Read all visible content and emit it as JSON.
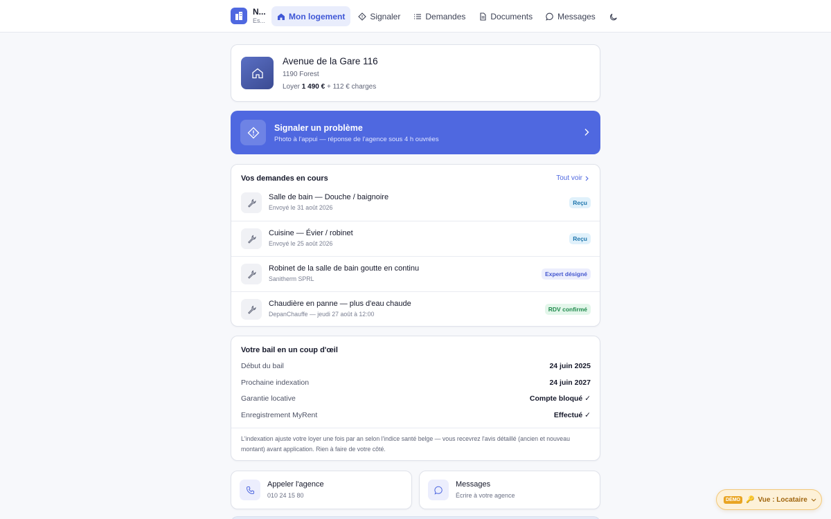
{
  "brand": {
    "name": "N...",
    "sub": "Es..."
  },
  "nav": {
    "items": [
      {
        "label": "Mon logement"
      },
      {
        "label": "Signaler"
      },
      {
        "label": "Demandes"
      },
      {
        "label": "Documents"
      },
      {
        "label": "Messages"
      }
    ]
  },
  "property": {
    "address": "Avenue de la Gare 116",
    "city": "1190 Forest",
    "rent_prefix": "Loyer",
    "rent": "1 490 €",
    "charges": "+ 112 € charges"
  },
  "report": {
    "title": "Signaler un problème",
    "subtitle": "Photo à l'appui — réponse de l'agence sous 4 h ouvrées"
  },
  "requests": {
    "title": "Vos demandes en cours",
    "see_all": "Tout voir",
    "items": [
      {
        "title": "Salle de bain — Douche / baignoire",
        "sub": "Envoyé le 31 août 2026",
        "status": "Reçu"
      },
      {
        "title": "Cuisine — Évier / robinet",
        "sub": "Envoyé le 25 août 2026",
        "status": "Reçu"
      },
      {
        "title": "Robinet de la salle de bain goutte en continu",
        "sub": "Sanitherm SPRL",
        "status": "Expert désigné"
      },
      {
        "title": "Chaudière en panne — plus d'eau chaude",
        "sub": "DepanChauffe — jeudi 27 août à 12:00",
        "status": "RDV confirmé"
      }
    ]
  },
  "lease": {
    "title": "Votre bail en un coup d'œil",
    "rows": [
      {
        "label": "Début du bail",
        "value": "24 juin 2025"
      },
      {
        "label": "Prochaine indexation",
        "value": "24 juin 2027"
      },
      {
        "label": "Garantie locative",
        "value": "Compte bloqué ✓"
      },
      {
        "label": "Enregistrement MyRent",
        "value": "Effectué ✓"
      }
    ],
    "note": "L'indexation ajuste votre loyer une fois par an selon l'indice santé belge — vous recevrez l'avis détaillé (ancien et nouveau montant) avant application. Rien à faire de votre côté."
  },
  "contacts": [
    {
      "title": "Appeler l'agence",
      "sub": "010 24 15 80"
    },
    {
      "title": "Messages",
      "sub": "Écrire à votre agence"
    }
  ],
  "demo": {
    "tag": "DÉMO",
    "key": "🔑",
    "label": "Vue : Locataire"
  },
  "colors": {
    "accent": "#4f68e0",
    "demo": "#e9a422"
  }
}
